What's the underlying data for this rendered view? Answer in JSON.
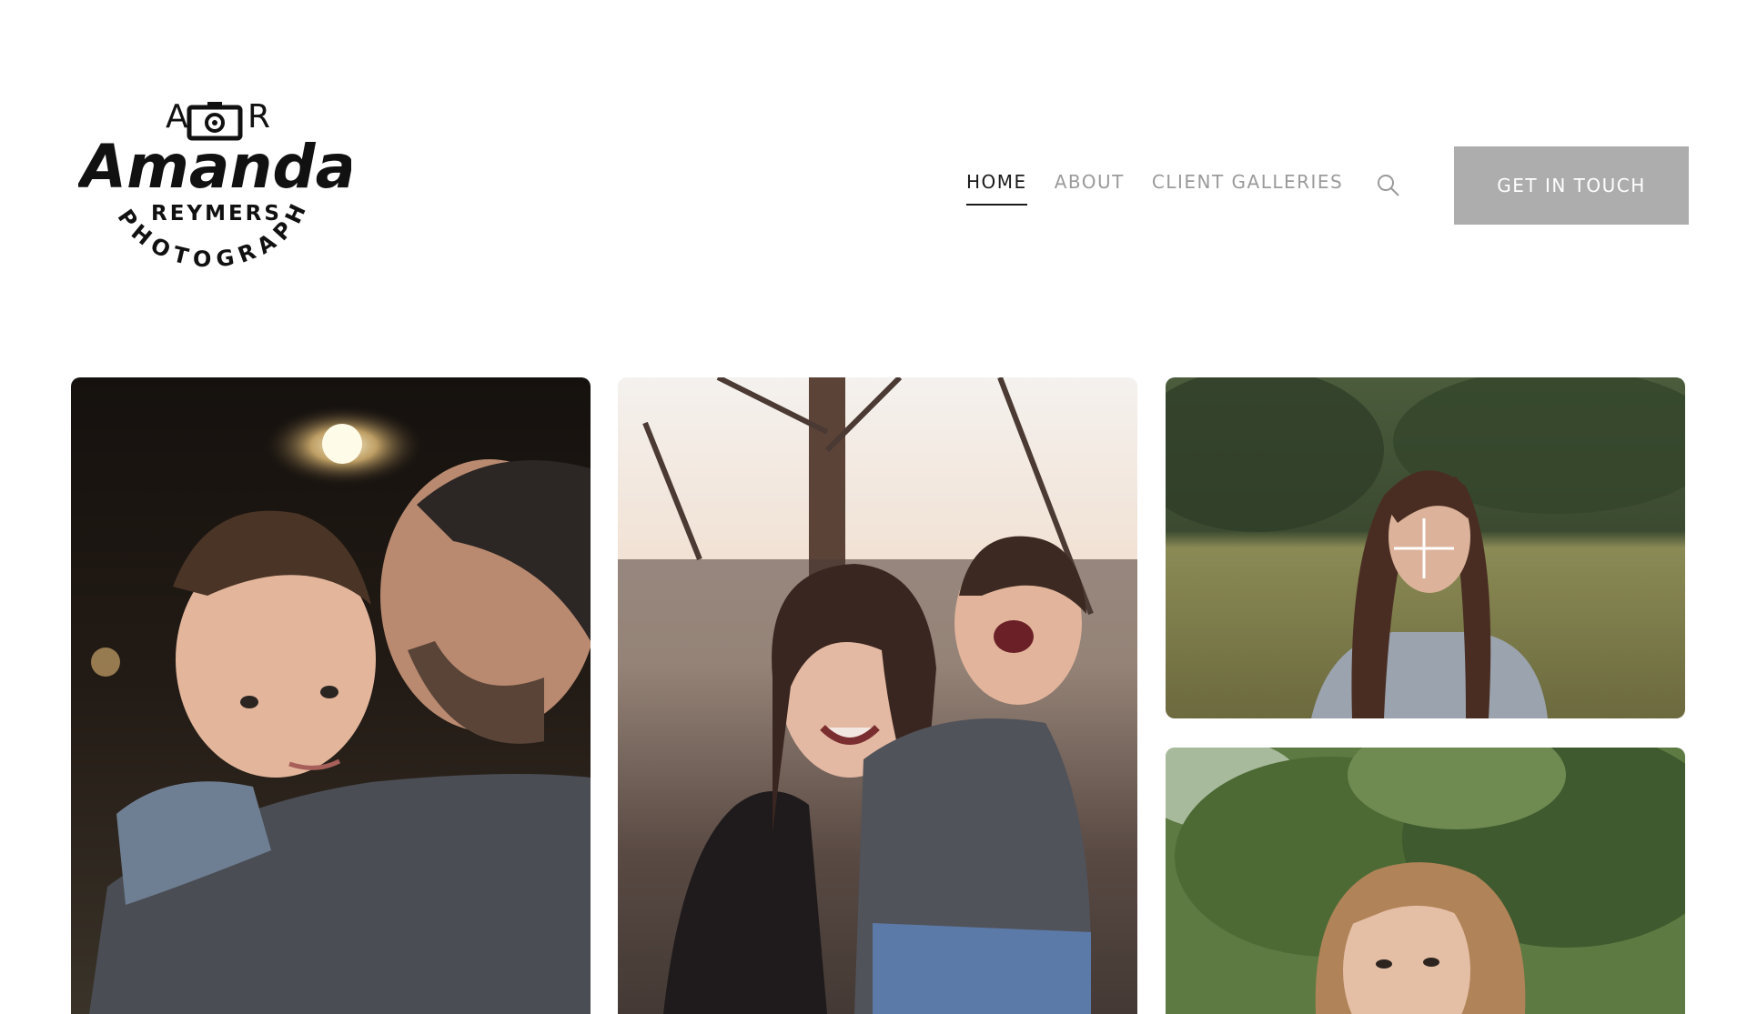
{
  "brand": {
    "initial_left": "A",
    "initial_right": "R",
    "script_name": "Amanda",
    "surname": "REYMERS",
    "tagline": "PHOTOGRAPHY",
    "icon": "camera-icon"
  },
  "nav": {
    "items": [
      {
        "label": "HOME",
        "active": true
      },
      {
        "label": "ABOUT",
        "active": false
      },
      {
        "label": "CLIENT GALLERIES",
        "active": false
      }
    ],
    "search_icon": "search-icon",
    "cta_label": "GET IN TOUCH"
  },
  "colors": {
    "accent_button": "#adadad",
    "nav_active": "#1a1a1a",
    "nav_inactive": "#9a9a9a"
  },
  "gallery": {
    "photos": [
      {
        "subject": "father-son-portrait"
      },
      {
        "subject": "mother-son-sunset"
      },
      {
        "subject": "senior-girl-field"
      },
      {
        "subject": "senior-girl-trees"
      }
    ]
  }
}
